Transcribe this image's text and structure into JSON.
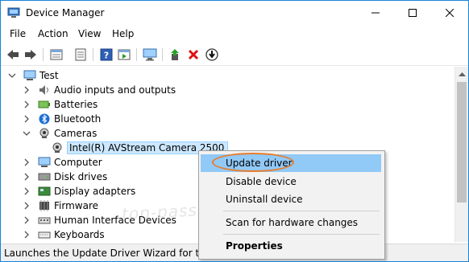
{
  "window": {
    "title": "Device Manager",
    "controls": {
      "minimize": "—",
      "maximize": "☐",
      "close": "✕"
    }
  },
  "menu": [
    "File",
    "Action",
    "View",
    "Help"
  ],
  "toolbar": {
    "icons": [
      "back-icon",
      "forward-icon",
      "properties-icon",
      "view-icon",
      "help-icon",
      "run-icon",
      "monitor-icon",
      "update-driver-icon",
      "uninstall-icon",
      "disable-icon"
    ]
  },
  "tree": {
    "root": "Test",
    "items": [
      {
        "label": "Audio inputs and outputs",
        "icon": "speaker-icon",
        "expanded": false
      },
      {
        "label": "Batteries",
        "icon": "battery-icon",
        "expanded": false
      },
      {
        "label": "Bluetooth",
        "icon": "bluetooth-icon",
        "expanded": false
      },
      {
        "label": "Cameras",
        "icon": "camera-icon",
        "expanded": true
      },
      {
        "label": "Intel(R) AVStream Camera 2500",
        "icon": "webcam-icon",
        "child": true,
        "selected": true
      },
      {
        "label": "Computer",
        "icon": "computer-icon",
        "expanded": false
      },
      {
        "label": "Disk drives",
        "icon": "disk-icon",
        "expanded": false
      },
      {
        "label": "Display adapters",
        "icon": "display-icon",
        "expanded": false
      },
      {
        "label": "Firmware",
        "icon": "firmware-icon",
        "expanded": false
      },
      {
        "label": "Human Interface Devices",
        "icon": "hid-icon",
        "expanded": false
      },
      {
        "label": "Keyboards",
        "icon": "keyboard-icon",
        "expanded": false
      }
    ]
  },
  "context_menu": {
    "items": [
      "Update driver",
      "Disable device",
      "Uninstall device",
      "Scan for hardware changes",
      "Properties"
    ],
    "highlighted": "Update driver"
  },
  "status": "Launches the Update Driver Wizard for the sel",
  "watermark": "top-password.com",
  "colors": {
    "accent": "#1883d7",
    "highlight": "#91c9f7",
    "annotation": "#e87d2a"
  }
}
